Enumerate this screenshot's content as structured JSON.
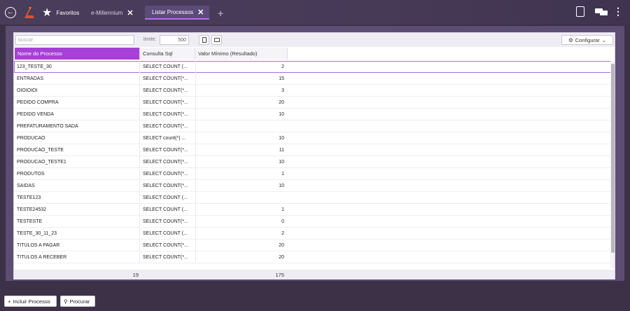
{
  "topbar": {
    "tabs": [
      {
        "label": "Favoritos"
      },
      {
        "label": "e-Millennium"
      },
      {
        "label": "Listar Processos"
      }
    ]
  },
  "toolbar": {
    "search_placeholder": "buscar",
    "limit_label": "limite:",
    "limit_value": "500",
    "config_label": "Configurar"
  },
  "table": {
    "columns": [
      "Nome do Processo",
      "Consulta Sql",
      "Valor Mínimo (Resultado)"
    ],
    "rows": [
      {
        "name": "123_TESTE_30",
        "sql": "SELECT COUNT (...",
        "value": "2"
      },
      {
        "name": "ENTRADAS",
        "sql": "SELECT COUNT(*...",
        "value": "15"
      },
      {
        "name": "OIOIOIOI",
        "sql": "SELECT COUNT(*...",
        "value": "3"
      },
      {
        "name": "PEDIDO COMPRA",
        "sql": "SELECT COUNT(*...",
        "value": "20"
      },
      {
        "name": "PEDIDO VENDA",
        "sql": "SELECT COUNT(*...",
        "value": "10"
      },
      {
        "name": "PREFATURAMENTO SADA",
        "sql": "SELECT COUNT(*...",
        "value": ""
      },
      {
        "name": "PRODUCAO",
        "sql": "SELECT count(*) ...",
        "value": "10"
      },
      {
        "name": "PRODUCAO_TESTE",
        "sql": "SELECT COUNT(*...",
        "value": "11"
      },
      {
        "name": "PRODUCAO_TESTE1",
        "sql": "SELECT COUNT(*...",
        "value": "10"
      },
      {
        "name": "PRODUTOS",
        "sql": "SELECT COUNT(*...",
        "value": "1"
      },
      {
        "name": "SAIDAS",
        "sql": "SELECT COUNT(*...",
        "value": "10"
      },
      {
        "name": "TESTE123",
        "sql": "SELECT COUNT (...",
        "value": ""
      },
      {
        "name": "TESTE24532",
        "sql": "SELECT COUNT (...",
        "value": "1"
      },
      {
        "name": "TESTESTE",
        "sql": "SELECT COUNT(*...",
        "value": "0"
      },
      {
        "name": "TESTE_30_11_23",
        "sql": "SELECT COUNT (...",
        "value": "2"
      },
      {
        "name": "TITULOS A PAGAR",
        "sql": "SELECT COUNT(*...",
        "value": "20"
      },
      {
        "name": "TITULOS A RECEBER",
        "sql": "SELECT COUNT(*...",
        "value": "20"
      }
    ],
    "selected_index": 0,
    "footer": {
      "count": "19",
      "total": "175"
    }
  },
  "bottom": {
    "add_label": "Incluir Processo",
    "search_label": "Procurar"
  },
  "colors": {
    "accent": "#a640d6",
    "topbar": "#4a3d5c",
    "background": "#3c3147"
  }
}
